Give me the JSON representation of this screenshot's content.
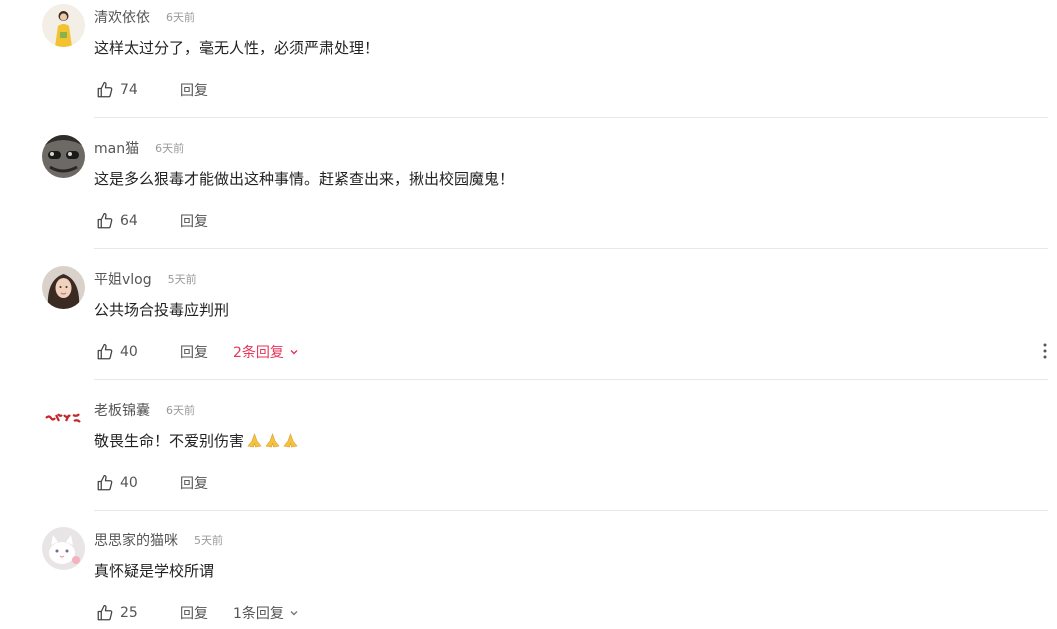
{
  "comments": [
    {
      "username": "清欢依依",
      "time": "6天前",
      "text": "这样太过分了，毫无人性，必须严肃处理！",
      "likes": "74",
      "reply_label": "回复",
      "avatar_icon": "avatar-yellow-dress-woman"
    },
    {
      "username": "man猫",
      "time": "6天前",
      "text": "这是多么狠毒才能做出这种事情。赶紧查出来，揪出校园魔鬼！",
      "likes": "64",
      "reply_label": "回复",
      "avatar_icon": "avatar-sunglasses-man"
    },
    {
      "username": "平姐vlog",
      "time": "5天前",
      "text": "公共场合投毒应判刑",
      "likes": "40",
      "reply_label": "回复",
      "replies_label": "2条回复",
      "replies_color": "#e6365a",
      "avatar_icon": "avatar-woman-portrait"
    },
    {
      "username": "老板锦囊",
      "time": "6天前",
      "text": "敬畏生命！不爱别伤害",
      "emoji": [
        "pray-icon",
        "pray-icon",
        "pray-icon"
      ],
      "likes": "40",
      "reply_label": "回复",
      "avatar_icon": "avatar-red-calligraphy-logo"
    },
    {
      "username": "思思家的猫咪",
      "time": "5天前",
      "text": "真怀疑是学校所谓",
      "likes": "25",
      "reply_label": "回复",
      "replies_label": "1条回复",
      "replies_color": "#555555",
      "avatar_icon": "avatar-white-cat"
    }
  ],
  "colors": {
    "text": "#222222",
    "secondary": "#555555",
    "muted": "#9a9a9a",
    "accent": "#e6365a",
    "divider": "#e8e8e8"
  },
  "icons": {
    "like": "thumbs-up-icon",
    "expand": "chevron-down-icon",
    "more": "more-vertical-icon"
  }
}
